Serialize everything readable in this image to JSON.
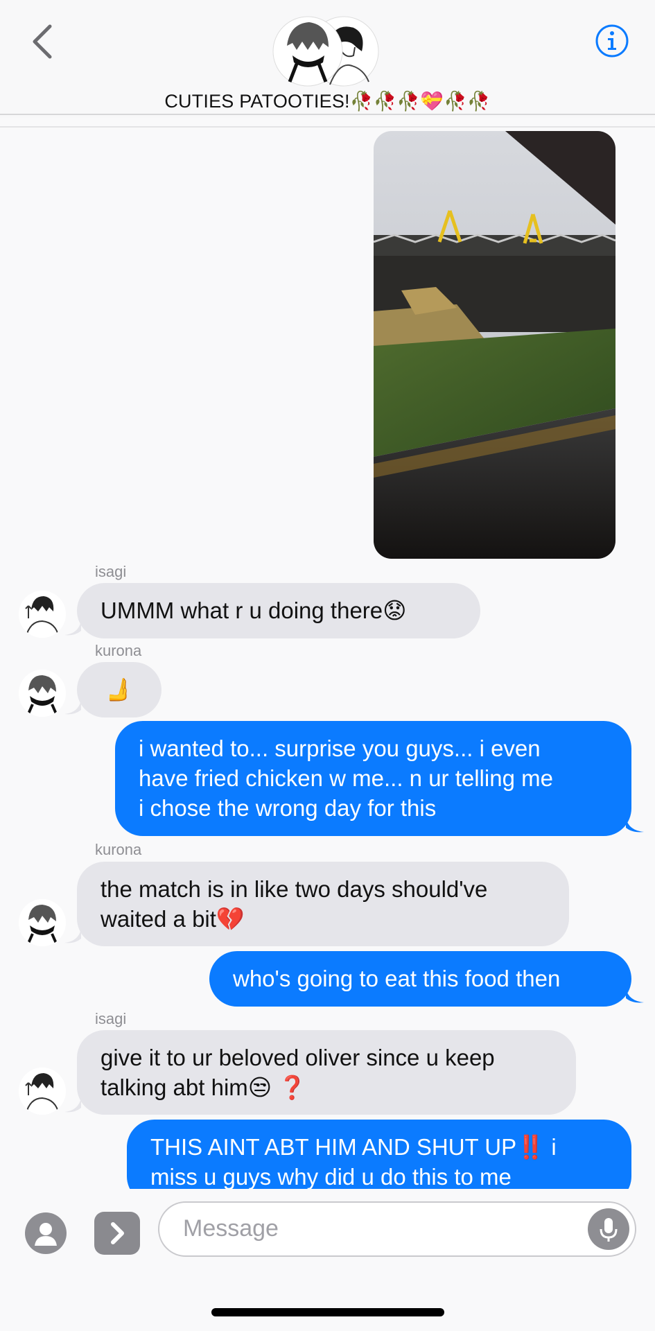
{
  "header": {
    "group_title": "CUTIES PATOOTIES!🥀🥀🥀💝🥀🥀"
  },
  "messages": [
    {
      "sender": "isagi",
      "text": "UMMM what r u doing there😟"
    },
    {
      "sender": "kurona",
      "text": "🫸"
    },
    {
      "text_lines": [
        "i wanted to... surprise you guys... i even",
        "have fried chicken w me... n ur telling me",
        "i chose the wrong day for this"
      ]
    },
    {
      "sender": "kurona",
      "text_lines": [
        "the match is in like two days should've",
        "waited a bit💔"
      ]
    },
    {
      "text": "who's going to eat this food then"
    },
    {
      "sender": "isagi",
      "text_lines": [
        "give it to ur beloved oliver since u keep",
        "talking abt him😒 ❓"
      ]
    },
    {
      "text_lines": [
        "THIS AINT ABT HIM AND SHUT UP‼️ i",
        "miss u guys why did u do this to me"
      ]
    }
  ],
  "composer": {
    "placeholder": "Message"
  },
  "icons": [
    "back-chevron-icon",
    "info-icon",
    "camera-icon",
    "apps-icon",
    "microphone-icon"
  ],
  "colors": {
    "outgoing_bubble": "#0b7bff",
    "incoming_bubble": "#e5e5ea",
    "accent": "#0b7bff"
  }
}
